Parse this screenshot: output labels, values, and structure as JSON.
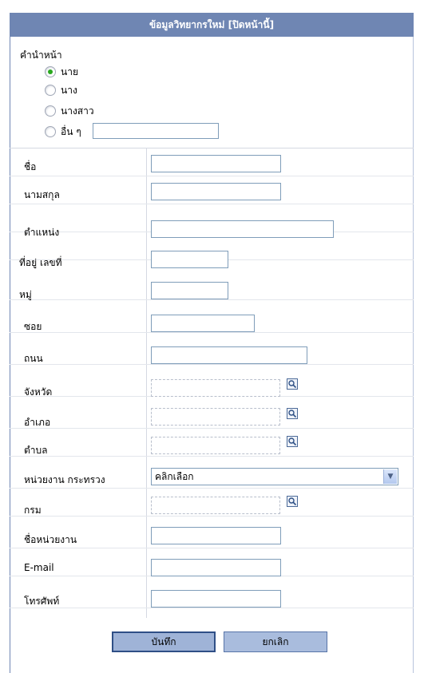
{
  "header": {
    "title": "ข้อมูลวิทยากรใหม่ [ปิดหน้านี้]"
  },
  "title_section": {
    "label": "คำนำหน้า",
    "options": [
      {
        "label": "นาย",
        "selected": true
      },
      {
        "label": "นาง",
        "selected": false
      },
      {
        "label": "นางสาว",
        "selected": false
      },
      {
        "label": "อื่น ๆ",
        "selected": false
      }
    ],
    "other_value": ""
  },
  "fields": {
    "first_name": {
      "label": "ชื่อ",
      "value": ""
    },
    "last_name": {
      "label": "นามสกุล",
      "value": ""
    },
    "position": {
      "label": "ตำแหน่ง",
      "value": ""
    },
    "house_no": {
      "label": "ที่อยู่ เลขที่",
      "value": ""
    },
    "moo": {
      "label": "หมู่",
      "value": ""
    },
    "soi": {
      "label": "ซอย",
      "value": ""
    },
    "road": {
      "label": "ถนน",
      "value": ""
    },
    "province": {
      "label": "จังหวัด",
      "value": ""
    },
    "district": {
      "label": "อำเภอ",
      "value": ""
    },
    "subdistrict": {
      "label": "ตำบล",
      "value": ""
    },
    "ministry": {
      "label": "หน่วยงาน กระทรวง",
      "selected": "คลิกเลือก"
    },
    "department": {
      "label": "กรม",
      "value": ""
    },
    "agency_name": {
      "label": "ชื่อหน่วยงาน",
      "value": ""
    },
    "email": {
      "label": "E-mail",
      "value": ""
    },
    "phone": {
      "label": "โทรศัพท์",
      "value": ""
    }
  },
  "buttons": {
    "save": "บันทึก",
    "cancel": "ยกเลิก"
  },
  "icons": {
    "lookup": "magnifier-icon",
    "dropdown": "chevron-down-icon"
  },
  "colors": {
    "header_bg": "#6f86b3",
    "button_bg": "#9fb3d7",
    "radio_selected": "#29a81e"
  }
}
